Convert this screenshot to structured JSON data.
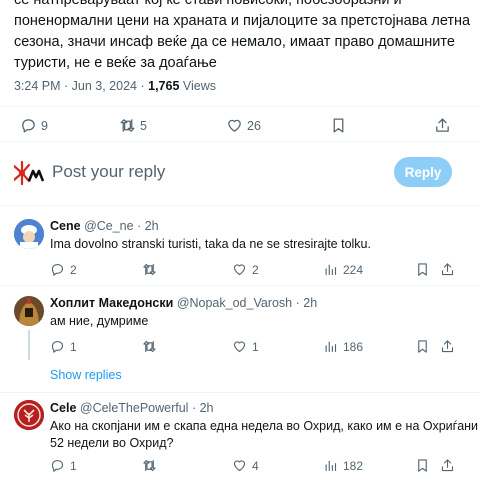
{
  "post": {
    "text_lines": [
      "се натпреваруваат кој ќе стави повисоки, побезобразни и",
      "поненормални цени на храната и пијалоците за претстојнава летна",
      "сезона, значи инсаф веќе да се немало, имаат право домашните",
      "туристи, не е веќе за доаѓање"
    ],
    "time": "3:24 PM · Jun 3, 2024 ·",
    "views_count": "1,765",
    "views_label": "Views",
    "replies": "9",
    "reposts": "5",
    "likes": "26"
  },
  "composer": {
    "placeholder": "Post your reply",
    "button": "Reply"
  },
  "replies": [
    {
      "name": "Cene",
      "handle": "@Ce_ne",
      "sep": "·",
      "time": "2h",
      "lines": [
        "Ima dovolno stranski turisti, taka da ne se stresirajte tolku."
      ],
      "replies": "2",
      "reposts": "",
      "likes": "2",
      "views": "224"
    },
    {
      "name": "Хоплит Македонски",
      "handle": "@Nopak_od_Varosh",
      "sep": "·",
      "time": "2h",
      "lines": [
        "ам ние, думриме"
      ],
      "replies": "1",
      "reposts": "",
      "likes": "1",
      "views": "186"
    },
    {
      "name": "Cele",
      "handle": "@CeleThePowerful",
      "sep": "·",
      "time": "2h",
      "lines": [
        "Ако на скопјани им е скапа една недела во Охрид, како им е на Охриѓани",
        "52 недели во Охрид?"
      ],
      "replies": "1",
      "reposts": "",
      "likes": "4",
      "views": "182"
    }
  ],
  "show_replies": "Show replies",
  "colors": {
    "accent": "#1d9bf0",
    "reply_button": "#8ecdf8",
    "muted": "#536471",
    "border": "#eff3f4"
  }
}
